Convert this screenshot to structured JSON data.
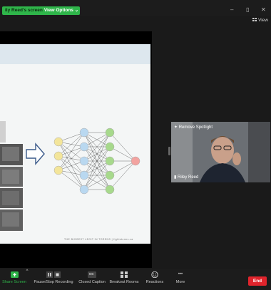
{
  "topbar": {
    "share_label": "ily Reed's screen",
    "view_options_label": "View Options ⌄",
    "minimize": "–",
    "restore": "▯",
    "close": "✕",
    "view_label": "View"
  },
  "slide": {
    "footer_text": "THE BIGGEST LEGIT IN TORENS  |  fightstorms.ca"
  },
  "video": {
    "spotlight_label": "Remove Spotlight",
    "participant_name": "Riley Reed"
  },
  "toolbar": {
    "share_screen": "Share Screen",
    "pause_stop_recording": "Pause/Stop Recording",
    "closed_caption": "Closed Caption",
    "cc_glyph": "CC",
    "breakout_rooms": "Breakout Rooms",
    "reactions": "Reactions",
    "more": "More",
    "more_glyph": "•••",
    "end": "End"
  },
  "colors": {
    "accent_green": "#2fb54a",
    "end_red": "#e0242c",
    "node_yellow": "#f3e59a",
    "node_blue": "#b9d8f0",
    "node_green": "#a7d98c",
    "node_red": "#f2a3a0"
  }
}
